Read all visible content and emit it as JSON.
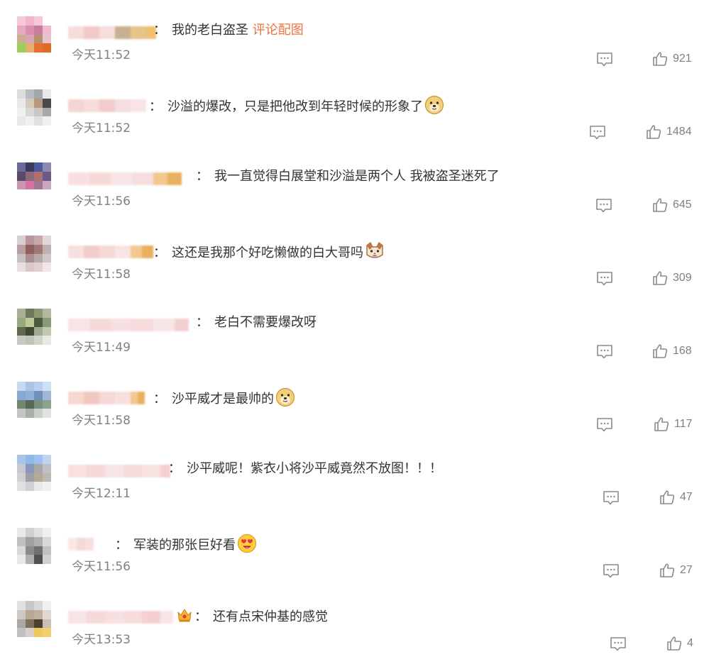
{
  "comments": [
    {
      "separator": "：",
      "text": "我的老白盗圣",
      "link": "评论配图",
      "time": "今天11:52",
      "likes": "921",
      "avatar_colors": [
        "#f6c9d8",
        "#f3b4cb",
        "#f6c9d8",
        "#ffffff",
        "#ffffff",
        "#e6a8c0",
        "#d88fb0",
        "#c77ca0",
        "#f0b8cc",
        "#ffffff",
        "#c8b090",
        "#d9a4b4",
        "#b89070",
        "#e8c4cc",
        "#ffffff",
        "#9ccf5a",
        "#e4b070",
        "#e57030",
        "#e06a20",
        "#ffffff",
        "#ffffff",
        "#ffffff",
        "#ffffff",
        "#ffffff",
        "#ffffff"
      ],
      "name_colors": [
        "#f6dcdc",
        "#f2c8c8",
        "#f6dede",
        "#c8b090",
        "#e6c48a",
        "#f0c070"
      ]
    },
    {
      "separator": "：",
      "text": "沙溢的爆改，只是把他改到年轻时候的形象了",
      "emoji": "doge",
      "time": "今天11:52",
      "likes": "1484",
      "avatar_colors": [
        "#dcdcdc",
        "#b8bcc0",
        "#a0a8a8",
        "#e8e8e8",
        "#ffffff",
        "#e8e8e8",
        "#d8c8b8",
        "#b89880",
        "#4a4a4a",
        "#ffffff",
        "#f0f0f0",
        "#d8d8d8",
        "#c8c8c8",
        "#a8a8a8",
        "#ffffff",
        "#e8e8e8",
        "#f0f0f0",
        "#e0e0e0",
        "#f0f0f0",
        "#ffffff",
        "#ffffff",
        "#ffffff",
        "#ffffff",
        "#ffffff",
        "#ffffff"
      ],
      "name_colors": [
        "#f4d4d4",
        "#f6dcdc",
        "#f2cccc",
        "#f6dede",
        "#f8e4e4",
        "#ffffff"
      ]
    },
    {
      "separator": "：",
      "text": "我一直觉得白展堂和沙溢是两个人  我被盗圣迷死了",
      "time": "今天11:56",
      "likes": "645",
      "avatar_colors": [
        "#6a6a9a",
        "#3a3a5a",
        "#4a5a9a",
        "#8a8ab0",
        "#ffffff",
        "#5a4a6a",
        "#8a6a7a",
        "#b07070",
        "#6a5a8a",
        "#ffffff",
        "#c898b0",
        "#d870a0",
        "#a07890",
        "#c8a8c0",
        "#ffffff",
        "#ffffff",
        "#ffffff",
        "#ffffff",
        "#ffffff",
        "#ffffff",
        "#ffffff",
        "#ffffff",
        "#ffffff",
        "#ffffff",
        "#ffffff"
      ],
      "name_colors": [
        "#f8e0e0",
        "#f6d8d8",
        "#f8e4e4",
        "#f6dede",
        "#f0c890",
        "#e8b060"
      ]
    },
    {
      "separator": "：",
      "text": "这还是我那个好吃懒做的白大哥吗",
      "emoji": "cat",
      "time": "今天11:58",
      "likes": "309",
      "avatar_colors": [
        "#d8d0d0",
        "#b89898",
        "#c8a8a8",
        "#e0d8d8",
        "#ffffff",
        "#b8a0a0",
        "#906060",
        "#a07878",
        "#c0b0b0",
        "#ffffff",
        "#c8c0c0",
        "#a89090",
        "#b8a8a8",
        "#d0c8c8",
        "#ffffff",
        "#e8e0e0",
        "#d8c8c8",
        "#e0d0d0",
        "#f0e8e8",
        "#ffffff",
        "#ffffff",
        "#ffffff",
        "#ffffff",
        "#ffffff",
        "#ffffff"
      ],
      "name_colors": [
        "#f8e0e0",
        "#f2cccc",
        "#f6d8d8",
        "#f8e4e4",
        "#f0c890",
        "#e8b060"
      ]
    },
    {
      "separator": "：",
      "text": "老白不需要爆改呀",
      "time": "今天11:49",
      "likes": "168",
      "avatar_colors": [
        "#a8b098",
        "#6a7a5a",
        "#8a9a70",
        "#b0b8a0",
        "#ffffff",
        "#9aa880",
        "#c0c898",
        "#4a5a3a",
        "#8a9878",
        "#ffffff",
        "#606850",
        "#404838",
        "#a0a890",
        "#c0c8b0",
        "#ffffff",
        "#c8ccc0",
        "#c0c4b8",
        "#d0d4c8",
        "#e8e8e0",
        "#ffffff",
        "#ffffff",
        "#ffffff",
        "#ffffff",
        "#ffffff",
        "#ffffff"
      ],
      "name_colors": [
        "#f8e4e4",
        "#f6dada",
        "#f8e0e0",
        "#f6dcdc",
        "#f8e6e6",
        "#f4d0d0"
      ]
    },
    {
      "separator": "：",
      "text": "沙平威才是最帅的",
      "emoji": "doge",
      "time": "今天11:58",
      "likes": "117",
      "avatar_colors": [
        "#c8d8f0",
        "#a8c4e8",
        "#b8d0f0",
        "#d0e0f4",
        "#ffffff",
        "#88a8d0",
        "#90b0d8",
        "#7090b8",
        "#a0b8d8",
        "#ffffff",
        "#708870",
        "#586858",
        "#7a9080",
        "#90a090",
        "#ffffff",
        "#c0c8c0",
        "#a8b0a8",
        "#c8d0c8",
        "#e0e4e0",
        "#ffffff",
        "#ffffff",
        "#ffffff",
        "#ffffff",
        "#ffffff",
        "#ffffff"
      ],
      "name_colors": [
        "#f6d8d0",
        "#f2c8c0",
        "#f6d8d8",
        "#f8e0dc",
        "#f0c890",
        "#e8b060"
      ]
    },
    {
      "separator": "：",
      "text": "沙平威呢！紫衣小将沙平威竟然不放图！！！",
      "time": "今天12:11",
      "likes": "47",
      "avatar_colors": [
        "#a8c4e8",
        "#90b8e8",
        "#a0c0f0",
        "#c0d4f0",
        "#ffffff",
        "#c8c8d0",
        "#8898b8",
        "#a8a8a8",
        "#c0c0c8",
        "#ffffff",
        "#d0d0d0",
        "#a0a0a8",
        "#b8a898",
        "#c0b8b0",
        "#ffffff",
        "#e0e0e0",
        "#d0d0d4",
        "#e8e8e8",
        "#f0f0f0",
        "#ffffff",
        "#ffffff",
        "#ffffff",
        "#ffffff",
        "#ffffff",
        "#ffffff"
      ],
      "name_colors": [
        "#f8e0e0",
        "#f6d8d8",
        "#f8e4e4",
        "#f6dcdc",
        "#f8e2e2",
        "#f4d0d0"
      ]
    },
    {
      "separator": "：",
      "text": "军装的那张巨好看",
      "emoji": "love",
      "time": "今天11:56",
      "likes": "27",
      "avatar_colors": [
        "#e8e8e8",
        "#d0d0d0",
        "#e0e0e0",
        "#f0f0f0",
        "#ffffff",
        "#c0c0c0",
        "#a0a0a0",
        "#b0b0b0",
        "#d8d8d8",
        "#ffffff",
        "#d8d8d8",
        "#8a8a8a",
        "#707070",
        "#c0c0c0",
        "#ffffff",
        "#e8e8e8",
        "#b0b0b0",
        "#505050",
        "#d0d0d0",
        "#ffffff",
        "#ffffff",
        "#ffffff",
        "#ffffff",
        "#ffffff",
        "#ffffff"
      ],
      "name_colors": [
        "#fae8e8",
        "#f6dada",
        "#f8e0e0",
        "#ffffff",
        "#ffffff",
        "#ffffff"
      ]
    },
    {
      "separator": "：",
      "text": "还有点宋仲基的感觉",
      "badge": "crown",
      "time": "今天13:53",
      "likes": "4",
      "avatar_colors": [
        "#e0e0e0",
        "#c8c8c8",
        "#d8d8d8",
        "#f0f0f0",
        "#ffffff",
        "#d0c8c0",
        "#b8a898",
        "#c0b0a0",
        "#e0d8d0",
        "#ffffff",
        "#a8a8a8",
        "#807060",
        "#504030",
        "#c8c0b8",
        "#ffffff",
        "#c0c0c0",
        "#d8d0c8",
        "#f0c860",
        "#f0d070",
        "#ffffff",
        "#ffffff",
        "#ffffff",
        "#ffffff",
        "#ffffff",
        "#ffffff"
      ],
      "name_colors": [
        "#f8e4e4",
        "#f6dada",
        "#f8e0e0",
        "#f6dcdc",
        "#f4d0d0",
        "#f8e6e6"
      ]
    }
  ]
}
